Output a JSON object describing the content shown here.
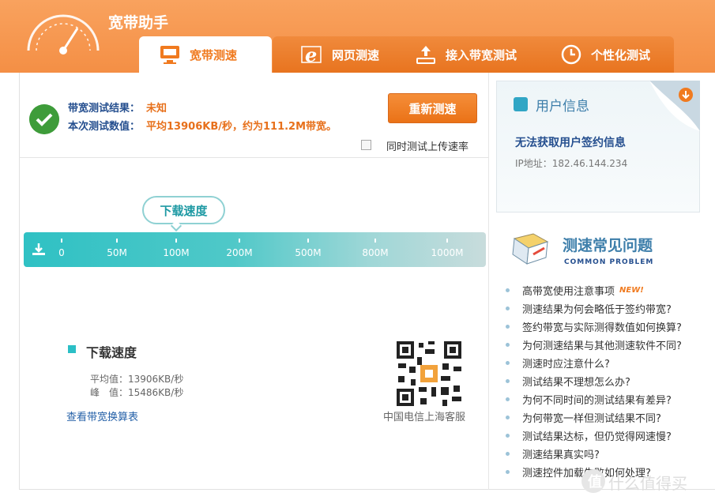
{
  "app": {
    "title": "宽带助手"
  },
  "tabs": [
    {
      "label": "宽带测速",
      "icon": "monitor-icon",
      "active": true
    },
    {
      "label": "网页测速",
      "icon": "ie-browser-icon",
      "active": false
    },
    {
      "label": "接入带宽测试",
      "icon": "network-upload-icon",
      "active": false
    },
    {
      "label": "个性化测试",
      "icon": "clock-icon",
      "active": false
    }
  ],
  "result": {
    "label1": "带宽测试结果：",
    "value1": "未知",
    "label2": "本次测试数值：",
    "value2": "平均13906KB/秒，约为111.2M带宽。",
    "retest_button": "重新测速",
    "upload_checkbox_label": "同时测试上传速率",
    "upload_checked": false
  },
  "speed_scale": {
    "bubble_label": "下载速度",
    "ticks": [
      "0",
      "50M",
      "100M",
      "200M",
      "500M",
      "800M",
      "1000M"
    ]
  },
  "download": {
    "title": "下载速度",
    "avg": "平均值：13906KB/秒",
    "peak": "峰　值：15486KB/秒",
    "conversion_link": "查看带宽换算表",
    "qr_caption": "中国电信上海客服"
  },
  "user_info": {
    "title": "用户信息",
    "message": "无法获取用户签约信息",
    "ip": "IP地址：182.46.144.234"
  },
  "faq": {
    "title": "测速常见问题",
    "subtitle": "COMMON PROBLEM",
    "new_badge": "NEW!",
    "items": [
      "高带宽使用注意事项",
      "测速结果为何会略低于签约带宽?",
      "签约带宽与实际测得数值如何换算?",
      "为何测速结果与其他测速软件不同?",
      "测速时应注意什么?",
      "测试结果不理想怎么办?",
      "为何不同时间的测试结果有差异?",
      "为何带宽一样但测试结果不同?",
      "测试结果达标，但仍觉得网速慢?",
      "测速结果真实吗?",
      "测速控件加载失败如何处理?"
    ]
  },
  "watermark": "什么值得买",
  "colors": {
    "accent": "#f48f45",
    "teal": "#2fc1c4",
    "link": "#2561a8"
  }
}
